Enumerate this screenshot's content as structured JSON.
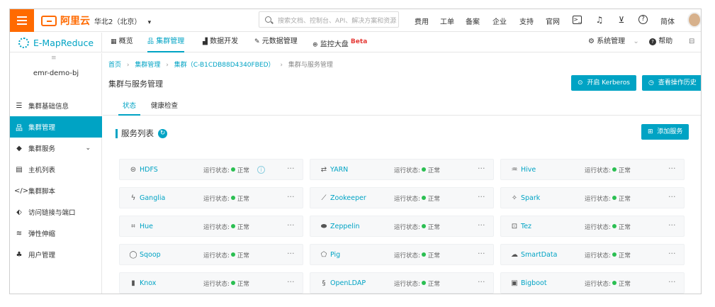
{
  "topbar": {
    "brand": "阿里云",
    "region": "华北2（北京）",
    "region_arrow": "▾",
    "search_placeholder": "搜索文档、控制台、API、解决方案和资源",
    "links": [
      "费用",
      "工单",
      "备案",
      "企业",
      "支持",
      "官网"
    ],
    "icons": [
      "terminal-icon",
      "bell-icon",
      "cart-icon",
      "help-icon"
    ],
    "lang": "简体"
  },
  "subnav": {
    "product": "E-MapReduce",
    "tabs": [
      {
        "icon": "grid-icon",
        "label": "概览"
      },
      {
        "icon": "cluster-icon",
        "label": "集群管理"
      },
      {
        "icon": "chart-icon",
        "label": "数据开发"
      },
      {
        "icon": "tool-icon",
        "label": "元数据管理"
      },
      {
        "icon": "monitor-icon",
        "label": "监控大盘"
      }
    ],
    "beta": "Beta",
    "system": "系统管理",
    "system_arrow": "⌄",
    "help": "帮助"
  },
  "sidebar": {
    "collapse": "≡",
    "cluster_name": "emr-demo-bj",
    "items": [
      {
        "icon": "list-icon",
        "label": "集群基础信息",
        "active": false
      },
      {
        "icon": "cluster-icon",
        "label": "集群管理",
        "active": true
      },
      {
        "icon": "service-icon",
        "label": "集群服务",
        "active": false,
        "chevron": "⌄"
      },
      {
        "icon": "host-icon",
        "label": "主机列表",
        "active": false
      },
      {
        "icon": "code-icon",
        "label": "集群脚本",
        "active": false
      },
      {
        "icon": "link-icon",
        "label": "访问链接与端口",
        "active": false
      },
      {
        "icon": "scale-icon",
        "label": "弹性伸缩",
        "active": false
      },
      {
        "icon": "user-icon",
        "label": "用户管理",
        "active": false
      }
    ]
  },
  "main": {
    "breadcrumb": [
      "首页",
      "集群管理",
      "集群（C-B1CDB88D4340FBED）",
      "集群与服务管理"
    ],
    "breadcrumb_sep": "›",
    "title": "集群与服务管理",
    "buttons": {
      "kerberos": "开启 Kerberos",
      "history": "查看操作历史"
    },
    "tabs": [
      "状态",
      "健康检查"
    ],
    "list_title": "服务列表",
    "add_service": "添加服务",
    "status_label": "运行状态:",
    "status_value": "正常",
    "more": "···",
    "services": [
      {
        "name": "HDFS",
        "icon": "hdfs-icon",
        "info": true
      },
      {
        "name": "YARN",
        "icon": "yarn-icon"
      },
      {
        "name": "Hive",
        "icon": "hive-icon"
      },
      {
        "name": "Ganglia",
        "icon": "ganglia-icon"
      },
      {
        "name": "Zookeeper",
        "icon": "zookeeper-icon"
      },
      {
        "name": "Spark",
        "icon": "spark-icon"
      },
      {
        "name": "Hue",
        "icon": "hue-icon"
      },
      {
        "name": "Zeppelin",
        "icon": "zeppelin-icon"
      },
      {
        "name": "Tez",
        "icon": "tez-icon"
      },
      {
        "name": "Sqoop",
        "icon": "sqoop-icon"
      },
      {
        "name": "Pig",
        "icon": "pig-icon"
      },
      {
        "name": "SmartData",
        "icon": "smartdata-icon"
      },
      {
        "name": "Knox",
        "icon": "knox-icon"
      },
      {
        "name": "OpenLDAP",
        "icon": "openldap-icon"
      },
      {
        "name": "Bigboot",
        "icon": "bigboot-icon"
      }
    ]
  }
}
